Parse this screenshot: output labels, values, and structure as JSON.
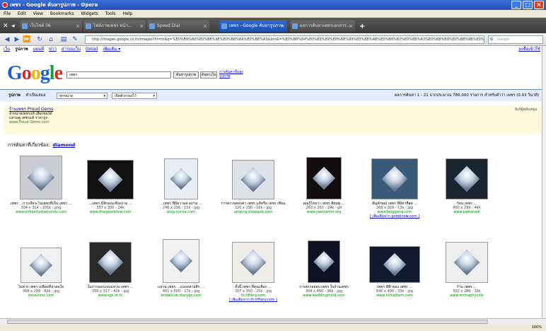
{
  "window": {
    "title": "เพชร - Google ค้นหารูปภาพ - Opera",
    "buttons": [
      "_",
      "□",
      "×"
    ]
  },
  "menu": [
    "File",
    "Edit",
    "View",
    "Bookmarks",
    "Widgets",
    "Tools",
    "Help"
  ],
  "tabs": [
    {
      "label": "เว็บไซต์ 06",
      "active": false
    },
    {
      "label": "ไฟล์ภาพเพชร หน้า...",
      "active": false
    },
    {
      "label": "Speed Dial",
      "active": false
    },
    {
      "label": "เพชร - Google ค้นหารูปภาพ",
      "active": true
    },
    {
      "label": "ผลการค้นหาเพชรเอกสาร...",
      "active": false
    }
  ],
  "address": {
    "url": "http://images.google.co.th/images?hl=th&q=%E0%B9%80%E0%B8%9E%E0%B8%8A%E0%B8%A3&btnG=%E0%B8%84%E0%B9%89%E0%B8%99%E0%B8%AB%E0%B8%B2%E0%B8%A3%E0%B8%B9%E0%B8%9B%E0%B8%A0%E0%B8%B2%E0%B8%9E&gbv=2",
    "search_placeholder": "Google"
  },
  "google_nav": {
    "items": [
      "เว็บ",
      "รูปภาพ",
      "แผนที่",
      "ข่าว",
      "สารบบเว็บ",
      "Gmail",
      "เพิ่มเติม ▾"
    ],
    "current_index": 1,
    "sign_in": "ลงชื่อเข้าใช้"
  },
  "logo_letters": [
    "G",
    "o",
    "o",
    "g",
    "l",
    "e"
  ],
  "query": "เพชร",
  "buttons": {
    "search_images": "ค้นหารูปภาพ",
    "search_web": "ค้นหาเว็บ",
    "advanced": "การค้นหาขั้นสูง รูปภาพ"
  },
  "options": {
    "label": "รูปภาพ",
    "filter_label": "ทำเป็นเสมอ",
    "size": "ทุกขนาด",
    "safe": "เปิดตัวกรองไว้",
    "stats": "ผลการค้นหา 1 - 21 จากประมาณ 786,000 รายการ สำหรับคำว่า เพชร (0.03 วินาที)"
  },
  "ad": {
    "title": "ร้านเพชร Proud Gems",
    "line1": "จำหน่ายเพชรแท้ เลือกชมได้",
    "line2": "แหวนคู่ เพชรแท้ ราคาถูก",
    "url": "www.Proud-Gems.com",
    "right": "ลิงก์ผู้สนับสนุน"
  },
  "related": {
    "label": "การค้นหาที่เกี่ยวข้อง:",
    "term": "diamond"
  },
  "row1": [
    {
      "cap": "เพชร ...การเจียระไนเพชรที่เป็น เพชร ...",
      "dim": "304 x 314 - 101k - png",
      "src": "www.kimberlydiamonds.com",
      "extra": ""
    },
    {
      "cap": "...เพชร มีลักษณะที่งดงาม ...",
      "dim": "357 x 300 - 24k",
      "src": "www.thaigoodview.com",
      "extra": ""
    },
    {
      "cap": "...เพชร ที่มีความสวยงาม ...",
      "dim": "246 x 296 - 15k - jpg",
      "src": "blog.nunsa.com",
      "extra": ""
    },
    {
      "cap": "การตรวจสอบค่า เพชร แท้หรือ เพชร เทียม",
      "dim": "320 x 290 - 16k - jpg",
      "src": "amjung.blogspot.com",
      "extra": ""
    },
    {
      "cap": "คุณรู้ไหมว่า เพชร สีชมพู ...",
      "dim": "263 x 263 - 24k - gif",
      "src": "www.jwelzamm.org",
      "extra": ""
    },
    {
      "cap": "สัญลักษณ์ เพชร ที่มีค่าที่สุด ...",
      "dim": "368 x 309 - 13k - jpg",
      "src": "www.bloggang.com",
      "extra": "[ เพิ่มเติมจาก gotoknow.com ]"
    },
    {
      "cap": "ก้อน เพชร ...",
      "dim": "450 x 299 - 44k",
      "src": "www.pattanadi",
      "extra": ""
    }
  ],
  "row2": [
    {
      "cap": "ไม่ควร เพชร เปลือยที่น่าสนใจ",
      "dim": "368 x 299 - 82k - jpg",
      "src": "zoneclinic.com",
      "extra": ""
    },
    {
      "cap": "ในการออกแบบแหวน เพชร ...",
      "dim": "350 x 317 - 42k - jpg",
      "src": "www.sgs.or.th",
      "extra": ""
    },
    {
      "cap": "แหวน เพชร ...แบบคลาสสิก ...",
      "dim": "461 x 500 - 27k - jpg",
      "src": "bridalclub.diarygo.com",
      "extra": ""
    },
    {
      "cap": "ทั้งนี้ เพชร ที่คุณเลือก ...",
      "dim": "357 x 350 - 25k - jpg",
      "src": "th.tiffany.com",
      "extra": "[ เพิ่มเติมจาก th.tiffany.com ]"
    },
    {
      "cap": "การตรวจสอบ เพชร ในร้านเพชร",
      "dim": "304 x 400 - 36k - jpg",
      "src": "www.weddingmind.com",
      "extra": ""
    },
    {
      "cap": "เพชร สีฟ้าของ เพชร ...",
      "dim": "640 x 400 - 33k - jpg",
      "src": "www.mthaifarm.com",
      "extra": ""
    },
    {
      "cap": "ร้าน เพชร ...",
      "dim": "302 x 286 - 30k",
      "src": "www.mrmaphycolo",
      "extra": ""
    }
  ],
  "status": {
    "zoom": "100%"
  }
}
